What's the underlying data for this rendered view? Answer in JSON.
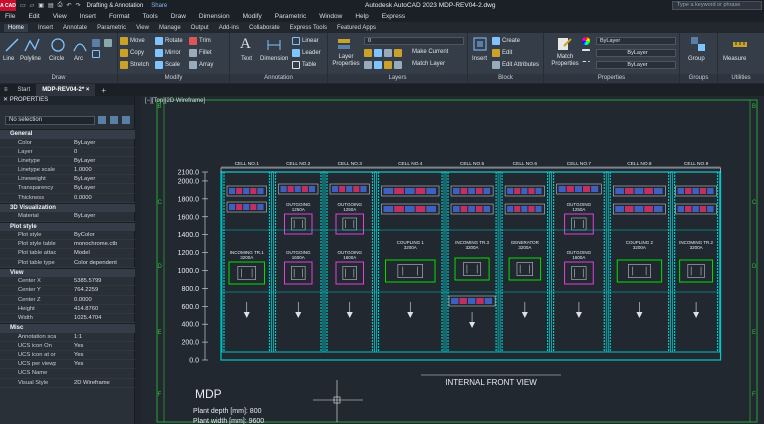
{
  "titlebar": {
    "logo": "A CAD",
    "workspace": "Drafting & Annotation",
    "share": "Share",
    "title": "Autodesk AutoCAD 2023  MDP-REV04-2.dwg",
    "search_placeholder": "Type a keyword or phrase"
  },
  "menu": [
    "File",
    "Edit",
    "View",
    "Insert",
    "Format",
    "Tools",
    "Draw",
    "Dimension",
    "Modify",
    "Parametric",
    "Window",
    "Help",
    "Express"
  ],
  "ribbon_tabs": [
    "Home",
    "Insert",
    "Annotate",
    "Parametric",
    "View",
    "Manage",
    "Output",
    "Add-ins",
    "Collaborate",
    "Express Tools",
    "Featured Apps"
  ],
  "ribbon": {
    "draw": {
      "title": "Draw",
      "line": "Line",
      "polyline": "Polyline",
      "circle": "Circle",
      "arc": "Arc"
    },
    "modify": {
      "title": "Modify",
      "move": "Move",
      "rotate": "Rotate",
      "trim": "Trim",
      "copy": "Copy",
      "mirror": "Mirror",
      "fillet": "Fillet",
      "stretch": "Stretch",
      "scale": "Scale",
      "array": "Array"
    },
    "annotation": {
      "title": "Annotation",
      "text": "Text",
      "dimension": "Dimension",
      "linear": "Linear",
      "leader": "Leader",
      "table": "Table"
    },
    "layers": {
      "title": "Layers",
      "layer_properties": "Layer Properties",
      "current_layer": "0",
      "make_current": "Make Current",
      "match_layer": "Match Layer"
    },
    "block": {
      "title": "Block",
      "insert": "Insert",
      "create": "Create",
      "edit": "Edit",
      "edit_attributes": "Edit Attributes"
    },
    "properties": {
      "title": "Properties",
      "match_properties": "Match Properties",
      "color": "ByLayer",
      "lineweight": "ByLayer",
      "linetype": "ByLayer"
    },
    "groups": {
      "title": "Groups",
      "group": "Group"
    },
    "utilities": {
      "title": "Utilities",
      "measure": "Measure"
    }
  },
  "file_tabs": [
    "Start",
    "MDP-REV04-2*"
  ],
  "viewport_label": "[−][Top][2D Wireframe]",
  "properties_palette": {
    "header": "PROPERTIES",
    "selection": "No selection",
    "sections": [
      {
        "name": "General",
        "rows": [
          [
            "Color",
            "ByLayer"
          ],
          [
            "Layer",
            "0"
          ],
          [
            "Linetype",
            "ByLayer"
          ],
          [
            "Linetype scale",
            "1.0000"
          ],
          [
            "Lineweight",
            "ByLayer"
          ],
          [
            "Transparency",
            "ByLayer"
          ],
          [
            "Thickness",
            "0.0000"
          ]
        ]
      },
      {
        "name": "3D Visualization",
        "rows": [
          [
            "Material",
            "ByLayer"
          ]
        ]
      },
      {
        "name": "Plot style",
        "rows": [
          [
            "Plot style",
            "ByColor"
          ],
          [
            "Plot style table",
            "monochrome.ctb"
          ],
          [
            "Plot table attache...",
            "Model"
          ],
          [
            "Plot table type",
            "Color dependent"
          ]
        ]
      },
      {
        "name": "View",
        "rows": [
          [
            "Center X",
            "5385.5799"
          ],
          [
            "Center Y",
            "764.2259"
          ],
          [
            "Center Z",
            "0.0000"
          ],
          [
            "Height",
            "414.8760"
          ],
          [
            "Width",
            "1025.4704"
          ]
        ]
      },
      {
        "name": "Misc",
        "rows": [
          [
            "Annotation scale",
            "1:1"
          ],
          [
            "UCS icon On",
            "Yes"
          ],
          [
            "UCS icon at origin",
            "Yes"
          ],
          [
            "UCS per viewport",
            "Yes"
          ],
          [
            "UCS Name",
            ""
          ],
          [
            "Visual Style",
            "2D Wireframe"
          ]
        ]
      }
    ]
  },
  "drawing": {
    "y_axis": [
      "2100.0",
      "2000.0",
      "1800.0",
      "1600.0",
      "1400.0",
      "1200.0",
      "1000.0",
      "800.0",
      "600.0",
      "400.0",
      "200.0",
      "0.0"
    ],
    "cells": [
      "CELL NO.1",
      "CELL NO.2",
      "CELL NO.3",
      "CELL NO.4",
      "CELL NO.5",
      "CELL NO.6",
      "CELL NO.7",
      "CELL NO.8",
      "CELL NO.9"
    ],
    "grid_letters": [
      "B",
      "C",
      "D",
      "E",
      "F"
    ],
    "labels": {
      "outgoing": "OUTGOING",
      "rating_1250": "1250A",
      "rating_1600": "1600A",
      "incoming_tr1": "INCOMING TR.1",
      "incoming_tr2": "INCOMING TR.2",
      "coupling1": "COUPLING 1",
      "coupling2": "COUPLING 2",
      "generator": "GENERATOR",
      "incoming_tr3": "INCOMING TR.3",
      "rating_3200": "3200A"
    },
    "view_title": "INTERNAL FRONT VIEW",
    "mdp_title": "MDP",
    "plant_depth": "Plant depth [mm]: 800",
    "plant_width": "Plant width [mm]: 9600"
  },
  "colors": {
    "accent": "#c8102e",
    "panel_frame": "#00c8c8",
    "breaker": "#e040e0",
    "device_green": "#00e000",
    "canvas": "#212830"
  }
}
